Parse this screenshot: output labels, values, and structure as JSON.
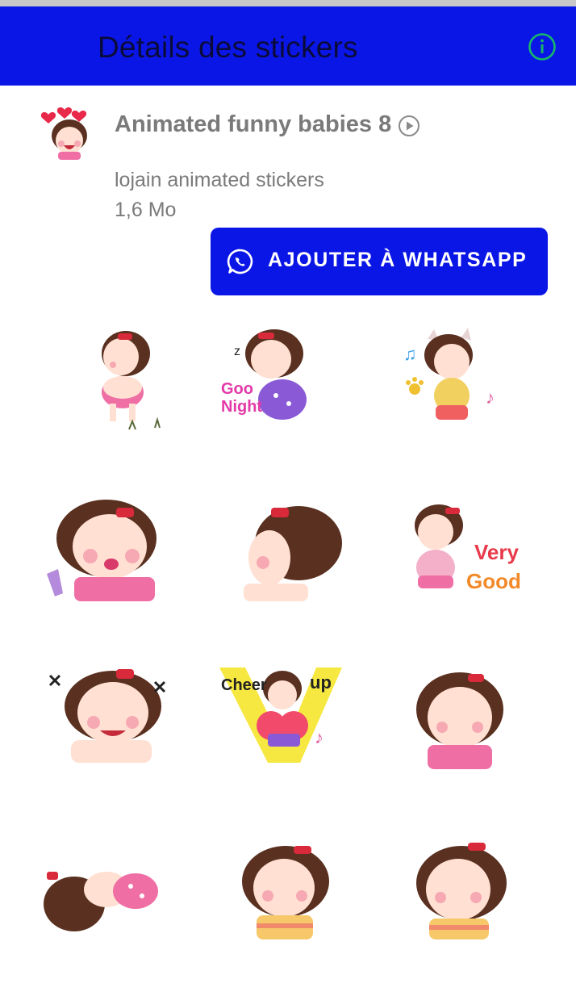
{
  "app_bar": {
    "title": "Détails des stickers",
    "info_icon": "info-circle-icon",
    "accent": "#0a16e6",
    "info_color": "#17b86a"
  },
  "pack": {
    "title": "Animated funny babies 8",
    "animated_icon": "play-circle-icon",
    "publisher": "lojain animated stickers",
    "size": "1,6 Mo"
  },
  "add_button": {
    "label": "AJOUTER À WHATSAPP",
    "icon": "whatsapp-icon"
  },
  "stickers": [
    {
      "id": 1,
      "caption": ""
    },
    {
      "id": 2,
      "caption": "Good Night"
    },
    {
      "id": 3,
      "caption": ""
    },
    {
      "id": 4,
      "caption": ""
    },
    {
      "id": 5,
      "caption": ""
    },
    {
      "id": 6,
      "caption": "Very Good"
    },
    {
      "id": 7,
      "caption": ""
    },
    {
      "id": 8,
      "caption": "Cheer up"
    },
    {
      "id": 9,
      "caption": ""
    },
    {
      "id": 10,
      "caption": ""
    },
    {
      "id": 11,
      "caption": ""
    },
    {
      "id": 12,
      "caption": ""
    }
  ]
}
